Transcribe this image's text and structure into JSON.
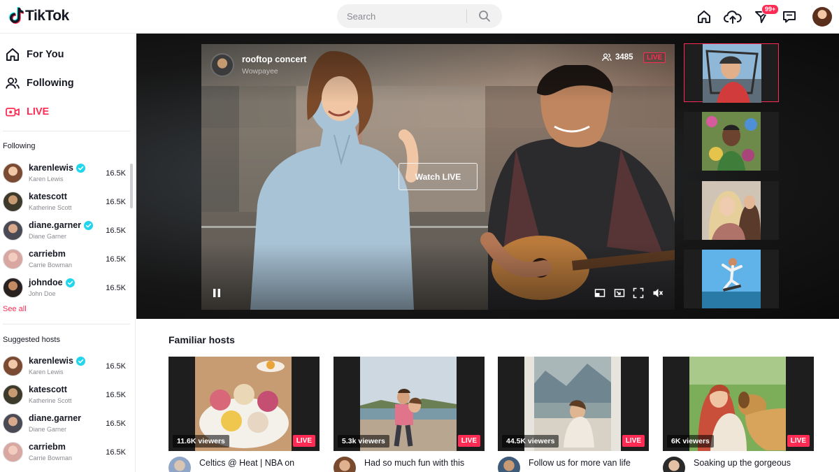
{
  "header": {
    "logo_text": "TikTok",
    "search": {
      "placeholder": "Search",
      "value": ""
    },
    "inbox_badge": "99+"
  },
  "sidebar": {
    "nav": [
      {
        "label": "For You",
        "icon": "home-icon"
      },
      {
        "label": "Following",
        "icon": "users-icon"
      },
      {
        "label": "LIVE",
        "icon": "live-camera-icon",
        "active": true
      }
    ],
    "following_heading": "Following",
    "following": [
      {
        "username": "karenlewis",
        "name": "Karen Lewis",
        "verified": true,
        "count": "16.5K"
      },
      {
        "username": "katescott",
        "name": "Katherine Scott",
        "verified": false,
        "count": "16.5K"
      },
      {
        "username": "diane.garner",
        "name": "Diane Garner",
        "verified": true,
        "count": "16.5K"
      },
      {
        "username": "carriebm",
        "name": "Carrie Bowman",
        "verified": false,
        "count": "16.5K"
      },
      {
        "username": "johndoe",
        "name": "John Doe",
        "verified": true,
        "count": "16.5K"
      }
    ],
    "see_all": "See all",
    "suggested_heading": "Suggested hosts",
    "suggested": [
      {
        "username": "karenlewis",
        "name": "Karen Lewis",
        "verified": true,
        "count": "16.5K"
      },
      {
        "username": "katescott",
        "name": "Katherine Scott",
        "verified": false,
        "count": "16.5K"
      },
      {
        "username": "diane.garner",
        "name": "Diane Garner",
        "verified": false,
        "count": "16.5K"
      },
      {
        "username": "carriebm",
        "name": "Carrie Bowman",
        "verified": false,
        "count": "16.5K"
      }
    ]
  },
  "player": {
    "title": "rooftop concert",
    "host": "Wowpayee",
    "viewers": "3485",
    "live_label": "LIVE",
    "watch_label": "Watch LIVE"
  },
  "familiar": {
    "heading": "Familiar hosts",
    "cards": [
      {
        "viewers": "11.6K viewers",
        "live": "LIVE",
        "title": "Celtics @ Heat | NBA on"
      },
      {
        "viewers": "5.3k viewers",
        "live": "LIVE",
        "title": "Had so much fun with this"
      },
      {
        "viewers": "44.5K viewers",
        "live": "LIVE",
        "title": "Follow us for more van life"
      },
      {
        "viewers": "6K viewers",
        "live": "LIVE",
        "title": "Soaking up the gorgeous"
      }
    ]
  },
  "colors": {
    "accent": "#fe2c55",
    "verified": "#20d5ec",
    "text": "#161823",
    "muted": "#8a8b91"
  }
}
